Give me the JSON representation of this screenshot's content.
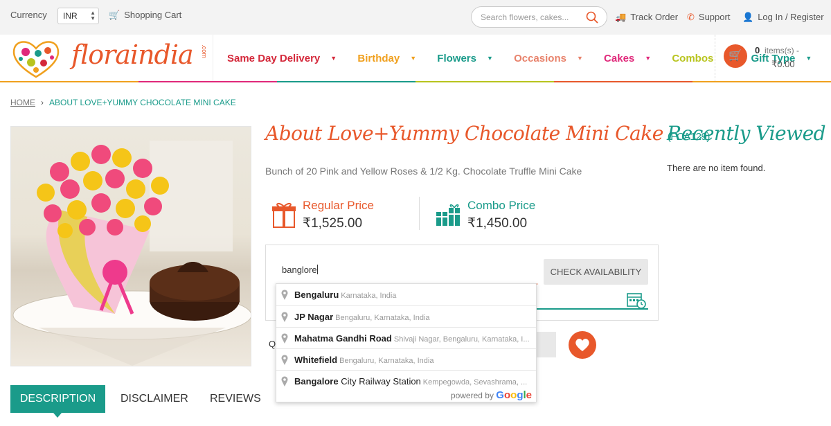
{
  "topbar": {
    "currency_label": "Currency",
    "currency_value": "INR",
    "cart_label": "Shopping Cart",
    "search_placeholder": "Search flowers, cakes...",
    "track_order": "Track Order",
    "support": "Support",
    "login": "Log In / Register"
  },
  "logo": {
    "text": "floraindia",
    "suffix": ".com"
  },
  "nav": [
    {
      "label": "Same Day Delivery",
      "color": "#d4283a"
    },
    {
      "label": "Birthday",
      "color": "#f0a01e"
    },
    {
      "label": "Flowers",
      "color": "#1a9b8a"
    },
    {
      "label": "Occasions",
      "color": "#e8826b"
    },
    {
      "label": "Cakes",
      "color": "#e0287a"
    },
    {
      "label": "Combos",
      "color": "#b8c41e"
    },
    {
      "label": "Gift Type",
      "color": "#1a9b8a"
    }
  ],
  "cart": {
    "count": "0",
    "items_label": "items(s) -",
    "total": "₹0.00"
  },
  "breadcrumb": {
    "home": "HOME",
    "current": "ABOUT LOVE+YUMMY CHOCOLATE MINI CAKE"
  },
  "product": {
    "title": "About Love+Yummy Chocolate Mini Cake",
    "code": "(FCA129)",
    "subtitle": "Bunch of 20 Pink and Yellow Roses & 1/2 Kg. Chocolate Truffle Mini Cake",
    "regular_label": "Regular Price",
    "regular_value": "₹1,525.00",
    "combo_label": "Combo Price",
    "combo_value": "₹1,450.00"
  },
  "check": {
    "input_value": "banglore",
    "button": "CHECK AVAILABILITY"
  },
  "qty_label": "Q",
  "autocomplete": {
    "items": [
      {
        "main": "Bengaluru",
        "secondary": "Karnataka, India"
      },
      {
        "main": "JP Nagar",
        "secondary": "Bengaluru, Karnataka, India"
      },
      {
        "main": "Mahatma Gandhi Road",
        "secondary": "Shivaji Nagar, Bengaluru, Karnataka, I..."
      },
      {
        "main": "Whitefield",
        "secondary": "Bengaluru, Karnataka, India"
      },
      {
        "main_bold": "Bangalore",
        "main_rest": " City Railway Station",
        "secondary": "Kempegowda, Sevashrama, ..."
      }
    ],
    "powered_by": "powered by",
    "google": "Google"
  },
  "recently_viewed": {
    "title": "Recently Viewed",
    "empty": "There are no item found."
  },
  "tabs": {
    "description": "DESCRIPTION",
    "disclaimer": "DISCLAIMER",
    "reviews": "REVIEWS"
  },
  "colors": {
    "brand_orange": "#e8582b",
    "brand_teal": "#1a9b8a"
  }
}
